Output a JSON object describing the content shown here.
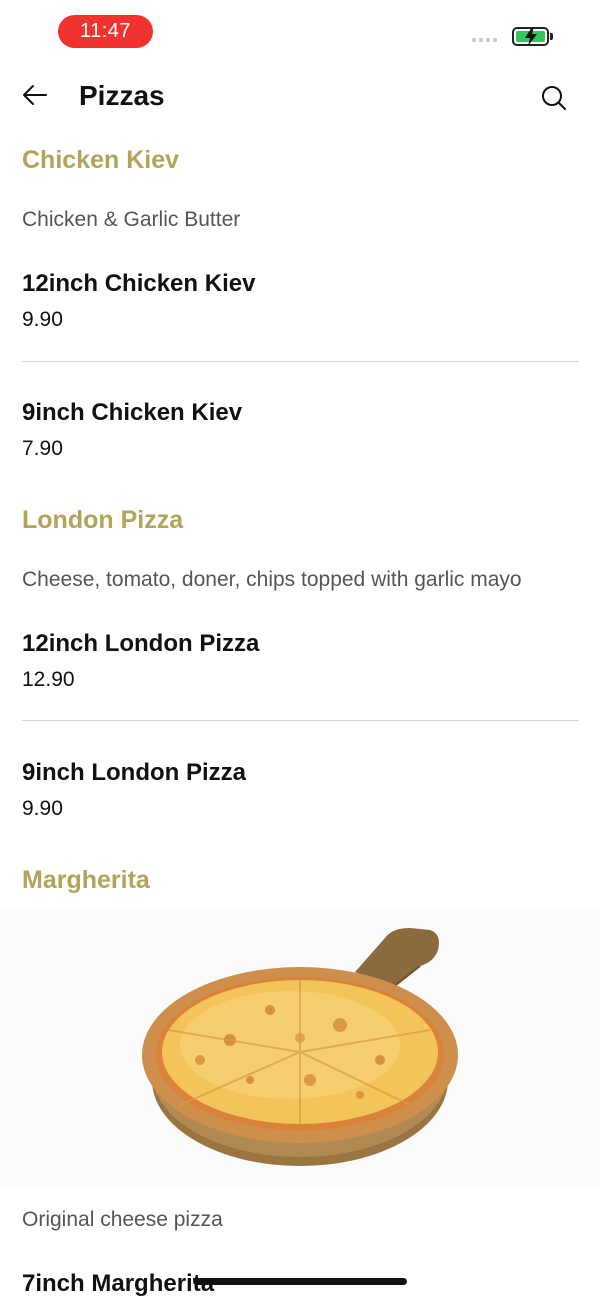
{
  "status": {
    "time": "11:47"
  },
  "header": {
    "title": "Pizzas"
  },
  "sections": [
    {
      "category": "Chicken Kiev",
      "description": "Chicken & Garlic Butter",
      "items": [
        {
          "name": "12inch Chicken Kiev",
          "price": "9.90"
        },
        {
          "name": "9inch Chicken Kiev",
          "price": "7.90"
        }
      ]
    },
    {
      "category": "London Pizza",
      "description": "Cheese, tomato, doner, chips topped with garlic mayo",
      "items": [
        {
          "name": "12inch London Pizza",
          "price": "12.90"
        },
        {
          "name": "9inch London Pizza",
          "price": "9.90"
        }
      ]
    },
    {
      "category": "Margherita",
      "description": "Original cheese pizza",
      "items": [
        {
          "name": "7inch Margherita"
        }
      ]
    }
  ],
  "colors": {
    "accent": "#b3a35b",
    "status_pill": "#f0332f",
    "battery": "#35c759"
  },
  "icons": {
    "back": "arrow-left-icon",
    "search": "search-icon"
  }
}
